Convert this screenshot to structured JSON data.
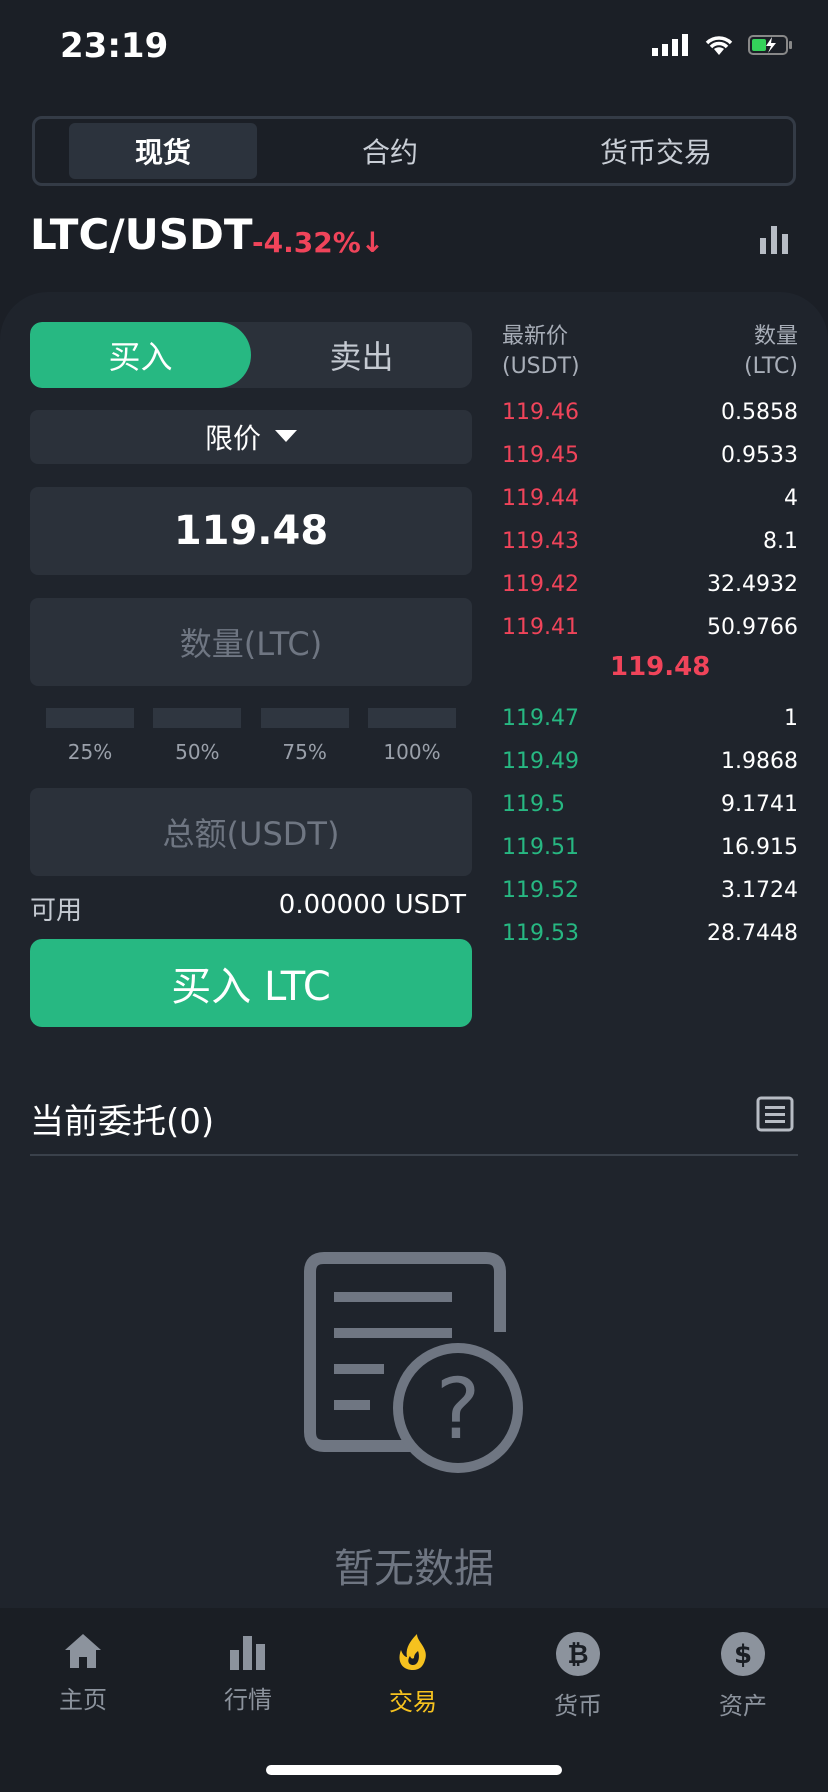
{
  "status": {
    "time": "23:19"
  },
  "tabs": [
    {
      "label": "现货",
      "active": true
    },
    {
      "label": "合约",
      "active": false
    },
    {
      "label": "货币交易",
      "active": false
    }
  ],
  "pair": {
    "name": "LTC/USDT",
    "change": "-4.32%↓"
  },
  "trade": {
    "buy_tab": "买入",
    "sell_tab": "卖出",
    "order_type": "限价",
    "price": "119.48",
    "quantity_placeholder": "数量(LTC)",
    "percents": [
      "25%",
      "50%",
      "75%",
      "100%"
    ],
    "total_placeholder": "总额(USDT)",
    "available_label": "可用",
    "available_value": "0.00000 USDT",
    "buy_button": "买入 LTC"
  },
  "orderbook": {
    "header_price": [
      "最新价",
      "(USDT)"
    ],
    "header_qty": [
      "数量",
      "(LTC)"
    ],
    "asks": [
      {
        "price": "119.46",
        "qty": "0.5858"
      },
      {
        "price": "119.45",
        "qty": "0.9533"
      },
      {
        "price": "119.44",
        "qty": "4"
      },
      {
        "price": "119.43",
        "qty": "8.1"
      },
      {
        "price": "119.42",
        "qty": "32.4932"
      },
      {
        "price": "119.41",
        "qty": "50.9766"
      }
    ],
    "mid_price": "119.48",
    "bids": [
      {
        "price": "119.47",
        "qty": "1"
      },
      {
        "price": "119.49",
        "qty": "1.9868"
      },
      {
        "price": "119.5",
        "qty": "9.1741"
      },
      {
        "price": "119.51",
        "qty": "16.915"
      },
      {
        "price": "119.52",
        "qty": "3.1724"
      },
      {
        "price": "119.53",
        "qty": "28.7448"
      }
    ]
  },
  "orders": {
    "title": "当前委托(0)",
    "empty": "暂无数据"
  },
  "nav": [
    {
      "label": "主页",
      "icon": "home-icon"
    },
    {
      "label": "行情",
      "icon": "bar-chart-icon"
    },
    {
      "label": "交易",
      "icon": "flame-icon",
      "active": true
    },
    {
      "label": "货币",
      "icon": "bitcoin-icon"
    },
    {
      "label": "资产",
      "icon": "dollar-icon"
    }
  ],
  "colors": {
    "green": "#27b882",
    "red": "#f0445a",
    "active_nav": "#f6c21f",
    "background": "#1b1f26"
  }
}
